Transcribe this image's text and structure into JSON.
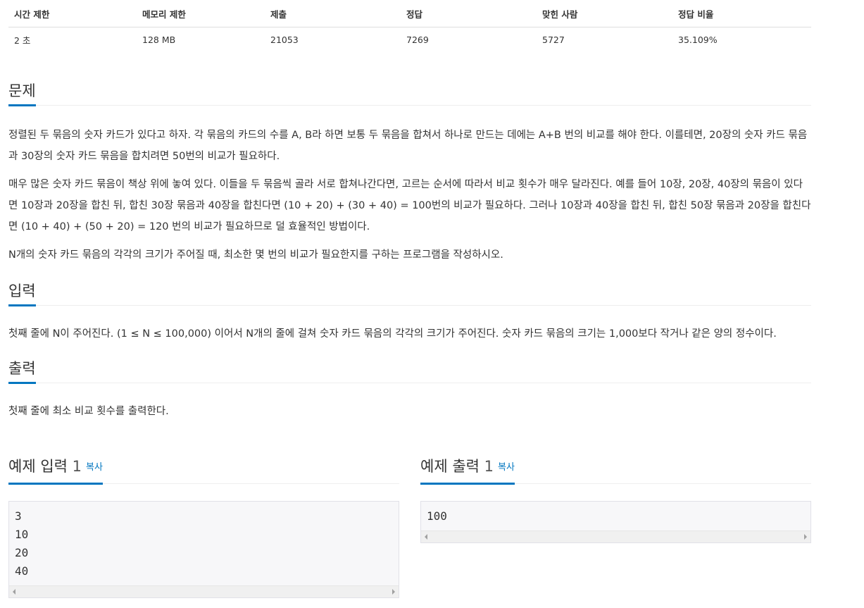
{
  "stats": {
    "headers": [
      "시간 제한",
      "메모리 제한",
      "제출",
      "정답",
      "맞힌 사람",
      "정답 비율"
    ],
    "values": [
      "2 초",
      "128 MB",
      "21053",
      "7269",
      "5727",
      "35.109%"
    ]
  },
  "problem": {
    "title": "문제",
    "paragraphs": [
      "정렬된 두 묶음의 숫자 카드가 있다고 하자. 각 묶음의 카드의 수를 A, B라 하면 보통 두 묶음을 합쳐서 하나로 만드는 데에는 A+B 번의 비교를 해야 한다. 이를테면, 20장의 숫자 카드 묶음과 30장의 숫자 카드 묶음을 합치려면 50번의 비교가 필요하다.",
      "매우 많은 숫자 카드 묶음이 책상 위에 놓여 있다. 이들을 두 묶음씩 골라 서로 합쳐나간다면, 고르는 순서에 따라서 비교 횟수가 매우 달라진다. 예를 들어 10장, 20장, 40장의 묶음이 있다면 10장과 20장을 합친 뒤, 합친 30장 묶음과 40장을 합친다면 (10 + 20) + (30 + 40) = 100번의 비교가 필요하다. 그러나 10장과 40장을 합친 뒤, 합친 50장 묶음과 20장을 합친다면 (10 + 40) + (50 + 20) = 120 번의 비교가 필요하므로 덜 효율적인 방법이다.",
      "N개의 숫자 카드 묶음의 각각의 크기가 주어질 때, 최소한 몇 번의 비교가 필요한지를 구하는 프로그램을 작성하시오."
    ]
  },
  "input": {
    "title": "입력",
    "paragraphs": [
      "첫째 줄에 N이 주어진다. (1 ≤ N ≤ 100,000) 이어서 N개의 줄에 걸쳐 숫자 카드 묶음의 각각의 크기가 주어진다. 숫자 카드 묶음의 크기는 1,000보다 작거나 같은 양의 정수이다."
    ]
  },
  "output": {
    "title": "출력",
    "paragraphs": [
      "첫째 줄에 최소 비교 횟수를 출력한다."
    ]
  },
  "sample_input": {
    "title": "예제 입력",
    "number": "1",
    "copy_label": "복사",
    "content": "3\n10\n20\n40"
  },
  "sample_output": {
    "title": "예제 출력",
    "number": "1",
    "copy_label": "복사",
    "content": "100"
  }
}
